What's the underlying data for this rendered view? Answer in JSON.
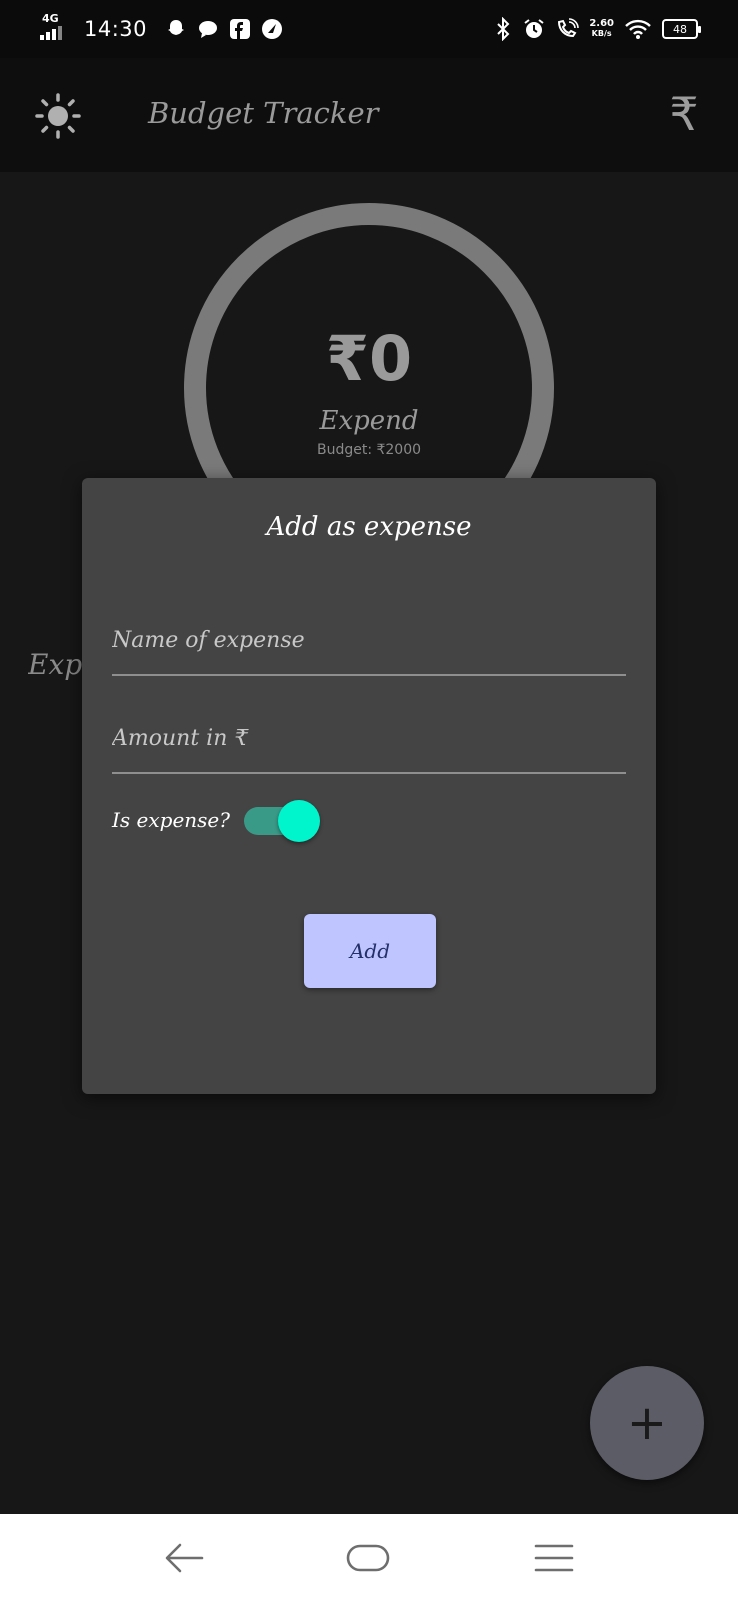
{
  "status_bar": {
    "network": "4G",
    "time": "14:30",
    "speed_value": "2.60",
    "speed_unit": "KB/s",
    "battery": "48",
    "icons": [
      "snapchat-icon",
      "message-icon",
      "facebook-icon",
      "app-icon",
      "bluetooth-icon",
      "alarm-icon",
      "wifi-call-icon",
      "wifi-icon",
      "battery-icon"
    ]
  },
  "app_bar": {
    "title": "Budget Tracker",
    "left_icon": "sun-icon",
    "right_icon": "rupee-icon",
    "right_glyph": "₹"
  },
  "summary": {
    "amount": "₹0",
    "label": "Expend",
    "budget": "Budget: ₹2000"
  },
  "section": {
    "heading": "Expe"
  },
  "dialog": {
    "title": "Add as expense",
    "name_placeholder": "Name of expense",
    "amount_placeholder": "Amount in ₹",
    "toggle_label": "Is expense?",
    "toggle_on": true,
    "add_label": "Add"
  },
  "fab": {
    "glyph": "+"
  },
  "colors": {
    "accent_toggle_thumb": "#00f5cc",
    "accent_toggle_track": "#3a9a88",
    "add_button_bg": "#bfc6ff",
    "dialog_bg": "#444444",
    "background": "#171717"
  }
}
